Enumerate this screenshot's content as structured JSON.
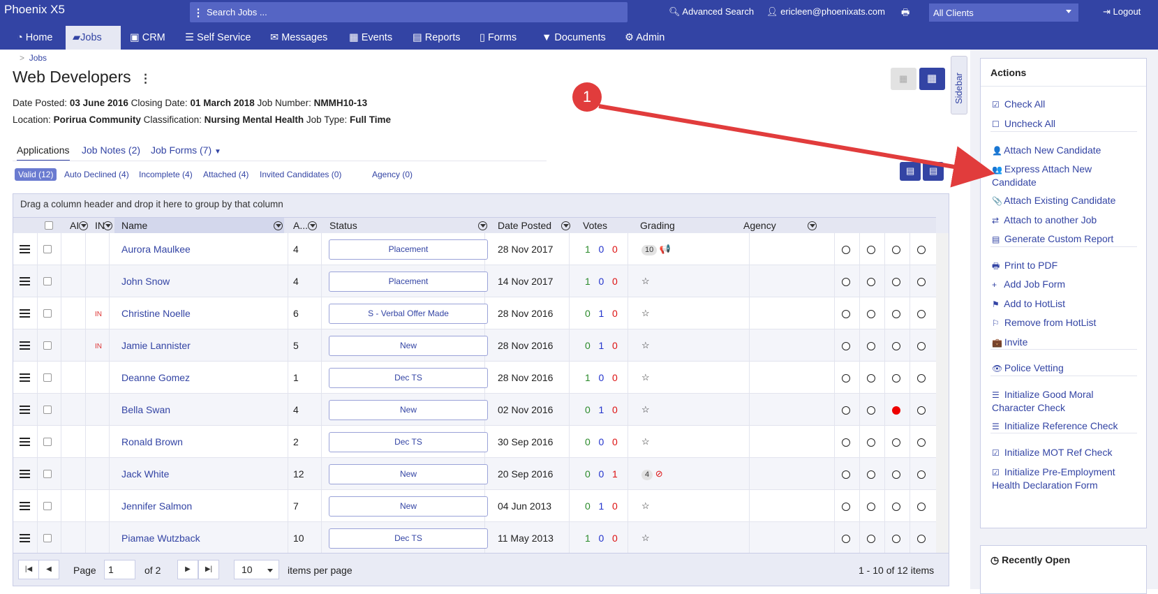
{
  "app": {
    "brand": "Phoenix X5"
  },
  "topbar": {
    "search_placeholder": "Search Jobs ...",
    "advanced_search": "Advanced Search",
    "user": "ericleen@phoenixats.com",
    "clients_value": "All Clients",
    "logout": "Logout"
  },
  "nav": {
    "items": [
      {
        "label": "Home"
      },
      {
        "label": "Jobs"
      },
      {
        "label": "CRM"
      },
      {
        "label": "Self Service"
      },
      {
        "label": "Messages"
      },
      {
        "label": "Events"
      },
      {
        "label": "Reports"
      },
      {
        "label": "Forms"
      },
      {
        "label": "Documents"
      },
      {
        "label": "Admin"
      }
    ]
  },
  "breadcrumb": {
    "sep": ">",
    "item": "Jobs"
  },
  "job": {
    "title": "Web Developers",
    "date_posted_label": "Date Posted:",
    "date_posted": "03 June 2016",
    "closing_label": "Closing Date:",
    "closing": "01 March 2018",
    "number_label": "Job Number:",
    "number": "NMMH10-13",
    "location_label": "Location:",
    "location": "Porirua Community",
    "class_label": "Classification:",
    "classification": "Nursing Mental Health",
    "type_label": "Job Type:",
    "type": "Full Time"
  },
  "sidebar_tab": "Sidebar",
  "tabs": [
    "Applications",
    "Job Notes (2)",
    "Job Forms (7)"
  ],
  "filters": [
    "Valid (12)",
    "Auto Declined (4)",
    "Incomplete (4)",
    "Attached (4)",
    "Invited Candidates (0)",
    "Agency (0)"
  ],
  "grid": {
    "group_hint": "Drag a column header and drop it here to group by that column",
    "headers": {
      "ai": "AI",
      "in": "IN",
      "name": "Name",
      "a": "A...",
      "status": "Status",
      "date": "Date Posted",
      "votes": "Votes",
      "grading": "Grading",
      "agency": "Agency"
    },
    "rows": [
      {
        "name": "Aurora Maulkee",
        "in": "",
        "app": "4",
        "status": "Placement",
        "date": "28 Nov 2017",
        "v1": "1",
        "v2": "0",
        "v3": "0",
        "grade": "10",
        "flag": "📢",
        "radios": [
          false,
          false,
          false,
          false
        ]
      },
      {
        "name": "John Snow",
        "in": "",
        "app": "4",
        "status": "Placement",
        "date": "14 Nov 2017",
        "v1": "1",
        "v2": "0",
        "v3": "0",
        "grade": "",
        "flag": "☆",
        "radios": [
          false,
          false,
          false,
          false
        ]
      },
      {
        "name": "Christine Noelle",
        "in": "IN",
        "app": "6",
        "status": "S - Verbal Offer Made",
        "date": "28 Nov 2016",
        "v1": "0",
        "v2": "1",
        "v3": "0",
        "grade": "",
        "flag": "☆",
        "radios": [
          false,
          false,
          false,
          false
        ]
      },
      {
        "name": "Jamie Lannister",
        "in": "IN",
        "app": "5",
        "status": "New",
        "date": "28 Nov 2016",
        "v1": "0",
        "v2": "1",
        "v3": "0",
        "grade": "",
        "flag": "☆",
        "radios": [
          false,
          false,
          false,
          false
        ]
      },
      {
        "name": "Deanne Gomez",
        "in": "",
        "app": "1",
        "status": "Dec TS",
        "date": "28 Nov 2016",
        "v1": "1",
        "v2": "0",
        "v3": "0",
        "grade": "",
        "flag": "☆",
        "radios": [
          false,
          false,
          false,
          false
        ]
      },
      {
        "name": "Bella Swan",
        "in": "",
        "app": "4",
        "status": "New",
        "date": "02 Nov 2016",
        "v1": "0",
        "v2": "1",
        "v3": "0",
        "grade": "",
        "flag": "☆",
        "radios": [
          false,
          false,
          true,
          false
        ]
      },
      {
        "name": "Ronald Brown",
        "in": "",
        "app": "2",
        "status": "Dec TS",
        "date": "30 Sep 2016",
        "v1": "0",
        "v2": "0",
        "v3": "0",
        "grade": "",
        "flag": "☆",
        "radios": [
          false,
          false,
          false,
          false
        ]
      },
      {
        "name": "Jack White",
        "in": "",
        "app": "12",
        "status": "New",
        "date": "20 Sep 2016",
        "v1": "0",
        "v2": "0",
        "v3": "1",
        "grade": "4",
        "flag": "⊘",
        "radios": [
          false,
          false,
          false,
          false
        ]
      },
      {
        "name": "Jennifer Salmon",
        "in": "",
        "app": "7",
        "status": "New",
        "date": "04 Jun 2013",
        "v1": "0",
        "v2": "1",
        "v3": "0",
        "grade": "",
        "flag": "☆",
        "radios": [
          false,
          false,
          false,
          false
        ]
      },
      {
        "name": "Piamae Wutzback",
        "in": "",
        "app": "10",
        "status": "Dec TS",
        "date": "11 May 2013",
        "v1": "1",
        "v2": "0",
        "v3": "0",
        "grade": "",
        "flag": "☆",
        "radios": [
          false,
          false,
          false,
          false
        ]
      }
    ]
  },
  "pager": {
    "page_label": "Page",
    "page": "1",
    "of": "of 2",
    "per_page": "10",
    "per_page_label": "items per page",
    "summary": "1 - 10 of 12 items"
  },
  "actions": {
    "title": "Actions",
    "items": [
      {
        "label": "Check All",
        "icon": "☑"
      },
      {
        "label": "Uncheck All",
        "icon": "☐"
      },
      {
        "label": "Attach New Candidate",
        "icon": "👤"
      },
      {
        "label": "Express Attach New Candidate",
        "icon": "👥"
      },
      {
        "label": "Attach Existing Candidate",
        "icon": "📎"
      },
      {
        "label": "Attach to another Job",
        "icon": "⇄"
      },
      {
        "label": "Generate Custom Report",
        "icon": "▤"
      },
      {
        "label": "Print to PDF",
        "icon": "🖶"
      },
      {
        "label": "Add Job Form",
        "icon": "+"
      },
      {
        "label": "Add to HotList",
        "icon": "⚑"
      },
      {
        "label": "Remove from HotList",
        "icon": "⚐"
      },
      {
        "label": "Invite",
        "icon": "💼"
      },
      {
        "label": "Police Vetting",
        "icon": "👁"
      },
      {
        "label": "Initialize Good Moral Character Check",
        "icon": "☰"
      },
      {
        "label": "Initialize Reference Check",
        "icon": "☰"
      },
      {
        "label": "Initialize MOT Ref Check",
        "icon": "☑"
      },
      {
        "label": "Initialize Pre-Employment Health Declaration Form",
        "icon": "☑"
      }
    ]
  },
  "recent": {
    "title": "Recently Open"
  },
  "callout": {
    "label": "1"
  },
  "colors": {
    "brand": "#3344a4",
    "link": "#3344a4",
    "arrow": "#e13c3c"
  }
}
